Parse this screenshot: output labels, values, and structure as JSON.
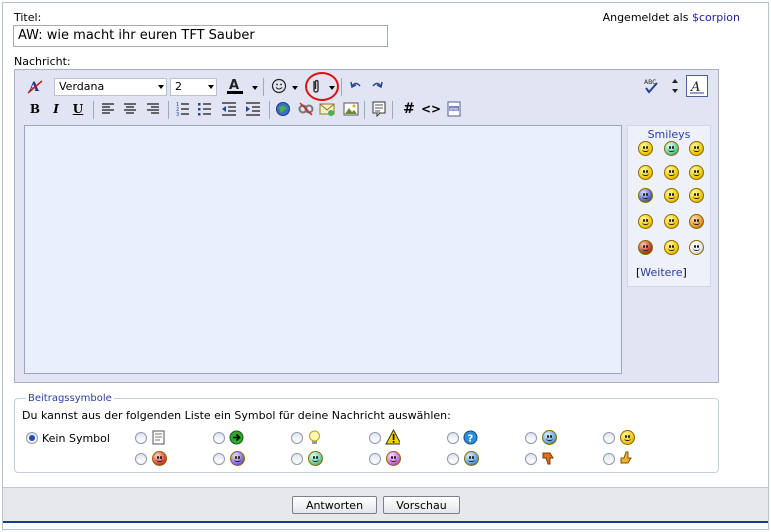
{
  "title_label": "Titel:",
  "title_value": "AW: wie macht ihr euren TFT Sauber",
  "login": {
    "prefix": "Angemeldet als",
    "user": "$corpion"
  },
  "message_label": "Nachricht:",
  "toolbar": {
    "font_value": "Verdana",
    "size_value": "2",
    "tooltips": [
      "remove-format",
      "font",
      "size",
      "text-color",
      "smilies",
      "attachment",
      "undo",
      "redo",
      "bold",
      "italic",
      "underline",
      "align-left",
      "align-center",
      "align-right",
      "ordered-list",
      "unordered-list",
      "outdent",
      "indent",
      "insert-link",
      "remove-link",
      "insert-email",
      "insert-image",
      "quote",
      "wrap-code",
      "html",
      "php",
      "spellcheck",
      "resize",
      "switch-mode"
    ]
  },
  "smilies": {
    "header": "Smileys",
    "more_open": "[",
    "more_link": "Weitere",
    "more_close": "]"
  },
  "post_icons": {
    "legend": "Beitragssymbole",
    "description": "Du kannst aus der folgenden Liste ein Symbol für deine Nachricht auswählen:",
    "none_label": "Kein Symbol",
    "icons_row1": [
      "post-icon",
      "arrow-icon",
      "lightbulb-icon",
      "warning-icon",
      "question-icon",
      "cool-icon",
      "smile-icon"
    ],
    "icons_row2": [
      "mad-icon",
      "angry-icon",
      "grin-icon",
      "wink-icon",
      "red-face-icon",
      "thumbs-down-icon",
      "thumbs-up-icon"
    ]
  },
  "buttons": {
    "submit": "Antworten",
    "preview": "Vorschau"
  },
  "colors": {
    "accent": "#2a3ea0",
    "editor_bg": "#e1e4f2",
    "textarea_bg": "#eaf0fb",
    "highlight_circle": "#e01010"
  }
}
